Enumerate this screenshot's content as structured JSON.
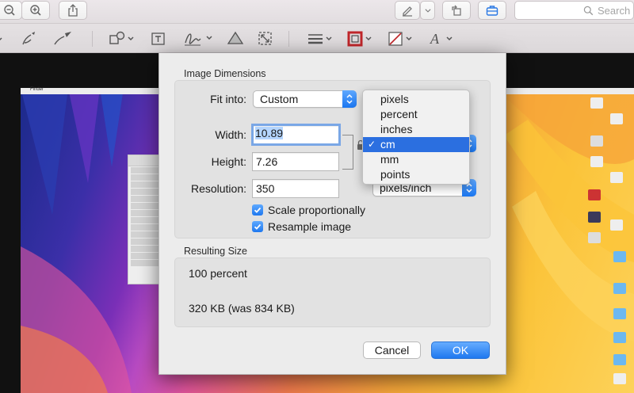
{
  "toolbar": {
    "search_placeholder": "Search"
  },
  "desktop": {
    "menubar_app": "Finder"
  },
  "dialog": {
    "image_dimensions_title": "Image Dimensions",
    "fit_into_label": "Fit into:",
    "fit_into_value": "Custom",
    "width_label": "Width:",
    "width_value": "10.89",
    "height_label": "Height:",
    "height_value": "7.26",
    "resolution_label": "Resolution:",
    "resolution_value": "350",
    "resolution_unit": "pixels/inch",
    "scale_proportionally_label": "Scale proportionally",
    "scale_proportionally_checked": true,
    "resample_image_label": "Resample image",
    "resample_image_checked": true,
    "resulting_size_title": "Resulting Size",
    "result_percent": "100 percent",
    "result_size": "320 KB (was 834 KB)",
    "cancel_label": "Cancel",
    "ok_label": "OK"
  },
  "unit_menu": {
    "items": [
      "pixels",
      "percent",
      "inches",
      "cm",
      "mm",
      "points"
    ],
    "selected": "cm"
  },
  "colors": {
    "accent": "#1f78ef",
    "menu_highlight": "#2b6fe0",
    "border_color_swatch": "#c0262a"
  }
}
